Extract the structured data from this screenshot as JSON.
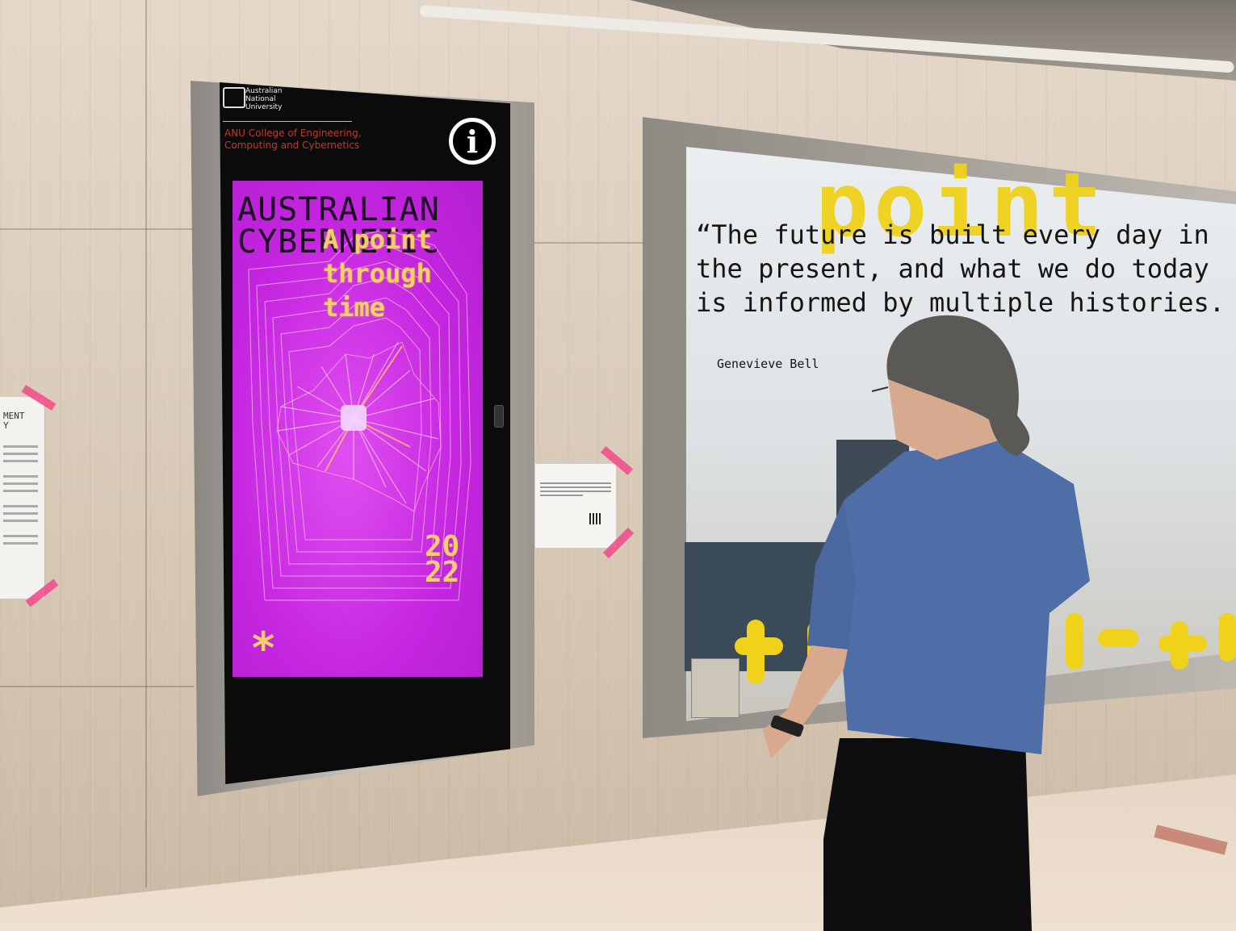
{
  "kiosk": {
    "university": "Australian\nNational\nUniversity",
    "college": "ANU College of Engineering,\nComputing and Cybernetics",
    "info_icon": "info-icon",
    "info_glyph": "i"
  },
  "poster": {
    "title": "AUSTRALIAN\nCYBERNETIC",
    "subtitle": "A point\nthrough\ntime",
    "year": "20\n22",
    "asterisk": "*"
  },
  "vitrine": {
    "ghost_word": "point",
    "quote": "“The future is built every day in\nthe present, and what we do today\nis informed by multiple histories.",
    "author": "Genevieve Bell"
  },
  "left_paper": {
    "heading": "MENT\nY"
  },
  "colors": {
    "poster_magenta": "#c425e0",
    "accent_yellow": "#f2cf6a",
    "tape_pink": "#f0508c",
    "vitrine_yellow": "#f0d21a"
  }
}
